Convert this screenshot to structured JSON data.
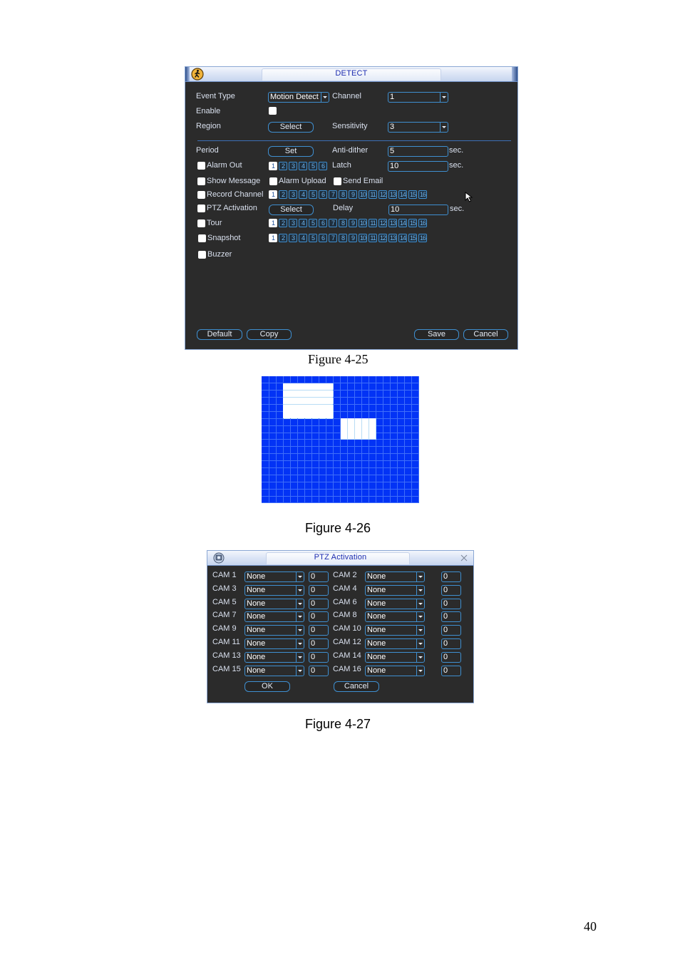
{
  "detect_window": {
    "title": "DETECT",
    "title_icon": "running-man-icon",
    "labels": {
      "event_type": "Event Type",
      "channel": "Channel",
      "enable": "Enable",
      "region": "Region",
      "sensitivity": "Sensitivity",
      "period": "Period",
      "anti_dither": "Anti-dither",
      "alarm_out": "Alarm Out",
      "latch": "Latch",
      "show_message": "Show Message",
      "alarm_upload": "Alarm Upload",
      "send_email": "Send Email",
      "record_channel": "Record Channel",
      "ptz_activation": "PTZ Activation",
      "delay": "Delay",
      "tour": "Tour",
      "snapshot": "Snapshot",
      "buzzer": "Buzzer",
      "sec": "sec."
    },
    "values": {
      "event_type": "Motion Detect",
      "channel": "1",
      "sensitivity": "3",
      "anti_dither": "5",
      "latch": "10",
      "delay": "10"
    },
    "enable_checked": false,
    "buttons": {
      "region_select": "Select",
      "period_set": "Set",
      "ptz_select": "Select",
      "default": "Default",
      "copy": "Copy",
      "save": "Save",
      "cancel": "Cancel"
    },
    "alarm_out_channels": [
      "1",
      "2",
      "3",
      "4",
      "5",
      "6"
    ],
    "alarm_out_selected": [
      "1"
    ],
    "record_channels": [
      "1",
      "2",
      "3",
      "4",
      "5",
      "6",
      "7",
      "8",
      "9",
      "10",
      "11",
      "12",
      "13",
      "14",
      "15",
      "16"
    ],
    "record_selected": [
      "1"
    ],
    "tour_channels": [
      "1",
      "2",
      "3",
      "4",
      "5",
      "6",
      "7",
      "8",
      "9",
      "10",
      "11",
      "12",
      "13",
      "14",
      "15",
      "16"
    ],
    "tour_selected": [
      "1"
    ],
    "snapshot_channels": [
      "1",
      "2",
      "3",
      "4",
      "5",
      "6",
      "7",
      "8",
      "9",
      "10",
      "11",
      "12",
      "13",
      "14",
      "15",
      "16"
    ],
    "snapshot_selected": [
      "1"
    ]
  },
  "figure_25_caption": "Figure 4-25",
  "region_grid": {
    "columns": 22,
    "rows": 18,
    "selected_blocks": [
      {
        "col_start": 3,
        "col_end": 9,
        "row_start": 1,
        "row_end": 5
      },
      {
        "col_start": 11,
        "col_end": 15,
        "row_start": 6,
        "row_end": 8
      }
    ],
    "colors": {
      "unselected": "#0333f5",
      "selected": "#ffffff"
    }
  },
  "figure_26_caption": "Figure 4-26",
  "ptz_window": {
    "title": "PTZ Activation",
    "title_icon": "ptz-camera-icon",
    "close_icon": "close-icon",
    "rows": [
      {
        "cam": "CAM 1",
        "type": "None",
        "value": "0"
      },
      {
        "cam": "CAM 2",
        "type": "None",
        "value": "0"
      },
      {
        "cam": "CAM 3",
        "type": "None",
        "value": "0"
      },
      {
        "cam": "CAM 4",
        "type": "None",
        "value": "0"
      },
      {
        "cam": "CAM 5",
        "type": "None",
        "value": "0"
      },
      {
        "cam": "CAM 6",
        "type": "None",
        "value": "0"
      },
      {
        "cam": "CAM 7",
        "type": "None",
        "value": "0"
      },
      {
        "cam": "CAM 8",
        "type": "None",
        "value": "0"
      },
      {
        "cam": "CAM 9",
        "type": "None",
        "value": "0"
      },
      {
        "cam": "CAM 10",
        "type": "None",
        "value": "0"
      },
      {
        "cam": "CAM 11",
        "type": "None",
        "value": "0"
      },
      {
        "cam": "CAM 12",
        "type": "None",
        "value": "0"
      },
      {
        "cam": "CAM 13",
        "type": "None",
        "value": "0"
      },
      {
        "cam": "CAM 14",
        "type": "None",
        "value": "0"
      },
      {
        "cam": "CAM 15",
        "type": "None",
        "value": "0"
      },
      {
        "cam": "CAM 16",
        "type": "None",
        "value": "0"
      }
    ],
    "buttons": {
      "ok": "OK",
      "cancel": "Cancel"
    }
  },
  "figure_27_caption": "Figure 4-27",
  "page_number": "40"
}
